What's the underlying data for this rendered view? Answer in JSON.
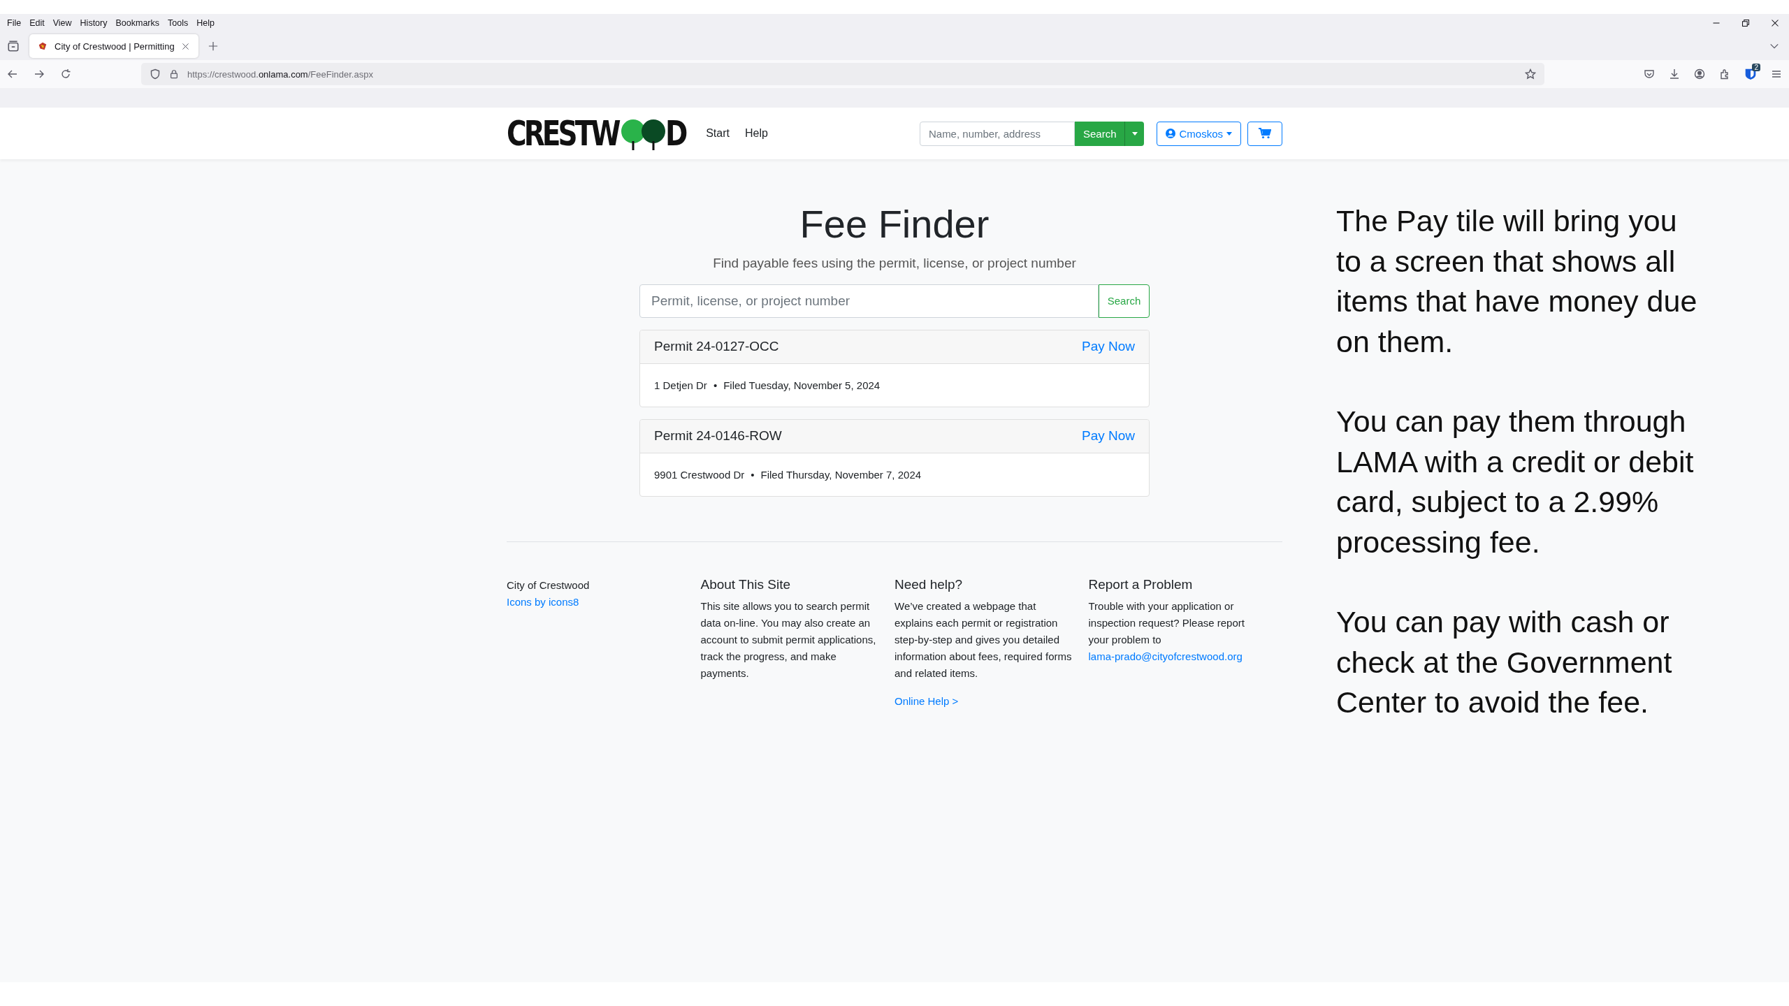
{
  "browser": {
    "menu": [
      "File",
      "Edit",
      "View",
      "History",
      "Bookmarks",
      "Tools",
      "Help"
    ],
    "tabs": [
      {
        "title": "City of Crestwood | Permitting",
        "selected": true
      }
    ],
    "url": {
      "prefix": "https://crestwood.",
      "domain": "onlama.com",
      "path": "/FeeFinder.aspx"
    },
    "extension_badge": "2"
  },
  "header": {
    "logo": {
      "left": "CRESTW",
      "right": "D"
    },
    "nav": [
      "Start",
      "Help"
    ],
    "search": {
      "placeholder": "Name, number, address",
      "button": "Search"
    },
    "user": "Cmoskos"
  },
  "main": {
    "title": "Fee Finder",
    "subtitle": "Find payable fees using the permit, license, or project number",
    "search": {
      "placeholder": "Permit, license, or project number",
      "button": "Search"
    },
    "results": [
      {
        "title": "Permit 24-0127-OCC",
        "action": "Pay Now",
        "address": "1 Detjen Dr",
        "separator": "•",
        "filed": "Filed Tuesday, November 5, 2024"
      },
      {
        "title": "Permit 24-0146-ROW",
        "action": "Pay Now",
        "address": "9901 Crestwood Dr",
        "separator": "•",
        "filed": "Filed Thursday, November 7, 2024"
      }
    ]
  },
  "footer": {
    "org": "City of Crestwood",
    "credit": "Icons by icons8",
    "columns": [
      {
        "heading": "About This Site",
        "text": "This site allows you to search permit data on-line. You may also create an account to submit permit applications, track the progress, and make payments."
      },
      {
        "heading": "Need help?",
        "text": "We’ve created a webpage that explains each permit or registration step-by-step and gives you detailed information about fees, required forms and related items.",
        "link": "Online Help >"
      },
      {
        "heading": "Report a Problem",
        "text": "Trouble with your application or inspection request? Please report your problem to",
        "link": "lama-prado@cityofcrestwood.org"
      }
    ]
  },
  "annotation": [
    "The Pay tile will bring you to a screen that shows all items that have money due on them.",
    "You can pay them through LAMA with a credit or debit card, subject to a 2.99% processing fee.",
    "You can pay with cash or check at the Government Center to avoid the fee."
  ]
}
